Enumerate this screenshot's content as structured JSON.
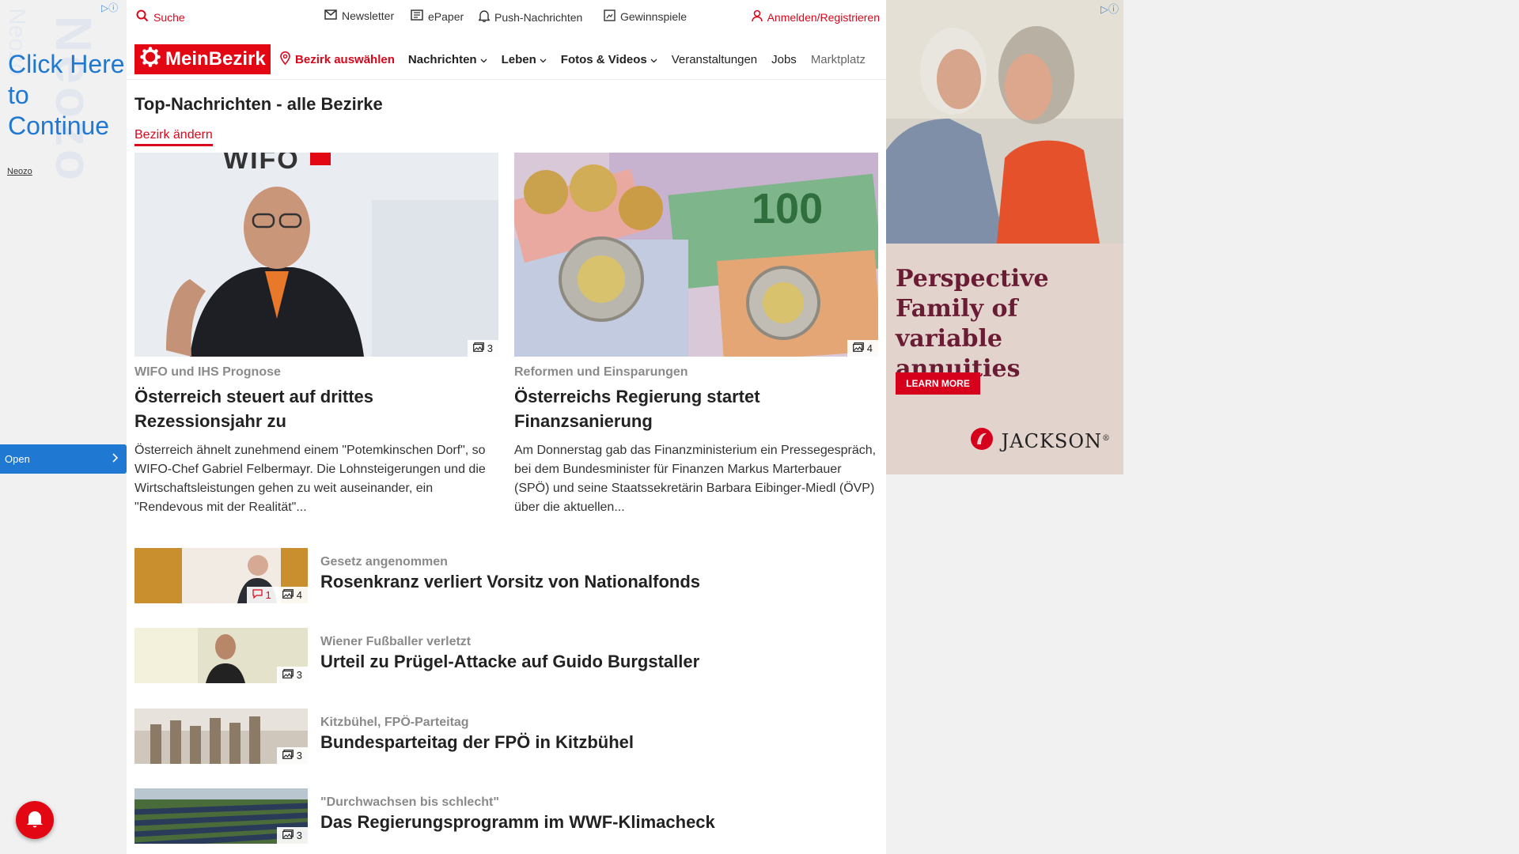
{
  "left_ad": {
    "watermark": "Neozo",
    "cta": "Click Here to Continue",
    "brand": "Neozo",
    "open_label": "Open"
  },
  "topbar": {
    "search": "Suche",
    "newsletter": "Newsletter",
    "epaper": "ePaper",
    "push": "Push-Nachrichten",
    "gewinnspiele": "Gewinnspiele",
    "login": "Anmelden/Registrieren"
  },
  "nav": {
    "logo": "MeinBezirk",
    "bezirk": "Bezirk auswählen",
    "items": [
      "Nachrichten",
      "Leben",
      "Fotos & Videos",
      "Veranstaltungen",
      "Jobs",
      "Marktplatz"
    ]
  },
  "section": {
    "title": "Top-Nachrichten - alle Bezirke",
    "change": "Bezirk ändern"
  },
  "featured": [
    {
      "kicker": "WIFO und IHS Prognose",
      "title": "Österreich steuert auf drittes Rezessionsjahr zu",
      "teaser": "Österreich ähnelt zunehmend einem \"Potemkinschen Dorf\", so WIFO-Chef Gabriel Felbermayr. Die Lohnsteigerungen und die Wirtschaftsleistungen gehen zu weit auseinander, ein \"Rendevous mit der Realität\"...",
      "images": "3",
      "image_text": "WIFO"
    },
    {
      "kicker": "Reformen und Einsparungen",
      "title": "Österreichs Regierung startet Finanzsanierung",
      "teaser": "Am Donnerstag gab das Finanzministerium ein Pressegespräch, bei dem Bundesminister für Finanzen Markus Marterbauer (SPÖ) und seine Staatssekretärin Barbara Eibinger-Miedl (ÖVP) über die aktuellen...",
      "images": "4",
      "image_text": "100"
    }
  ],
  "list": [
    {
      "kicker": "Gesetz angenommen",
      "title": "Rosenkranz verliert Vorsitz von Nationalfonds",
      "comments": "1",
      "images": "4"
    },
    {
      "kicker": "Wiener Fußballer verletzt",
      "title": "Urteil zu Prügel-Attacke auf Guido Burgstaller",
      "images": "3"
    },
    {
      "kicker": "Kitzbühel, FPÖ-Parteitag",
      "title": "Bundesparteitag der FPÖ in Kitzbühel",
      "images": "3"
    },
    {
      "kicker": "\"Durchwachsen bis schlecht\"",
      "title": "Das Regierungsprogramm im WWF-Klimacheck",
      "images": "3"
    }
  ],
  "right_ad": {
    "headline": "Perspective Family of variable annuities",
    "button": "LEARN MORE",
    "brand": "JACKSON",
    "brand_mark": "®"
  },
  "colors": {
    "brand_red": "#e30613",
    "link_red": "#d9071b",
    "ad_blue": "#1f78d1"
  }
}
